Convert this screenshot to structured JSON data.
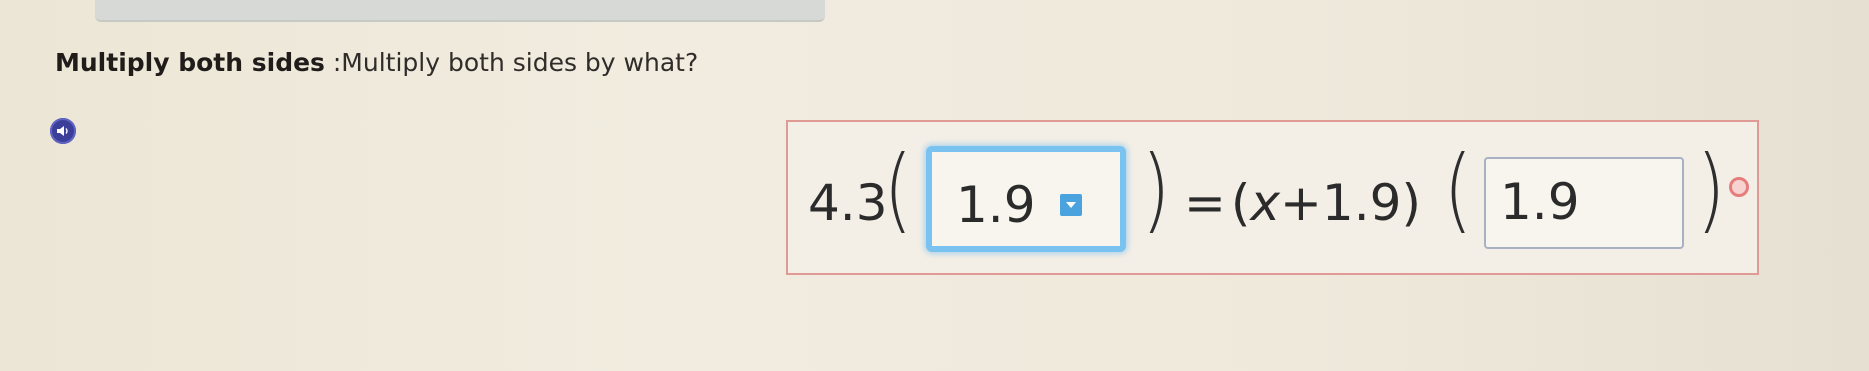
{
  "instruction": {
    "bold": "Multiply both sides",
    "rest": " :Multiply both sides by what?"
  },
  "audio": {
    "icon": "speaker-icon"
  },
  "equation": {
    "left_coefficient": "4.3",
    "input_1_value": "1.9",
    "middle": {
      "equals": "=",
      "open_paren": "(",
      "variable": "x",
      "plus": "+",
      "constant": "1.9",
      "close_paren": ")"
    },
    "input_2_value": "1.9",
    "paren_open": "(",
    "paren_close": ")"
  },
  "colors": {
    "focused_input_border": "#7ac3f1",
    "dropdown_accent": "#4aa3de",
    "equation_border": "#e09a95",
    "audio_button": "#3b3f9a",
    "status_dot": "#e67c7c"
  }
}
